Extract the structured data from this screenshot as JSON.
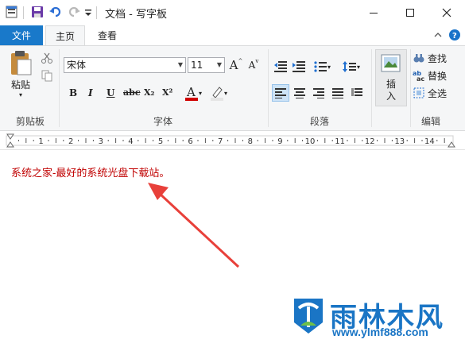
{
  "window": {
    "title": "文档 - 写字板"
  },
  "tabs": {
    "file": "文件",
    "home": "主页",
    "view": "查看"
  },
  "clipboard": {
    "paste": "粘贴",
    "group": "剪贴板"
  },
  "font": {
    "family": "宋体",
    "size": "11",
    "group": "字体",
    "bold": "B",
    "italic": "I",
    "underline": "U",
    "strikethrough": "abc",
    "subscript": "X₂",
    "superscript": "X²",
    "font_color_glyph": "A",
    "grow_glyph": "A",
    "shrink_glyph": "A"
  },
  "paragraph": {
    "group": "段落"
  },
  "insert": {
    "label_line1": "插",
    "label_line2": "入"
  },
  "editing": {
    "find": "查找",
    "replace": "替换",
    "select_all": "全选",
    "group": "编辑"
  },
  "ruler": {
    "numbers": [
      "1",
      "2",
      "3",
      "4",
      "5",
      "6",
      "7",
      "8",
      "9",
      "10",
      "11",
      "12",
      "13",
      "14"
    ]
  },
  "document": {
    "text": "系统之家-最好的系统光盘下载站。"
  },
  "watermark": {
    "name": "雨林木风",
    "url": "www.ylmf888.com"
  },
  "colors": {
    "accent": "#1979ca",
    "text_red": "#c00000",
    "arrow": "#e8403a",
    "watermark": "#1a75c5"
  },
  "icons": [
    "app-icon",
    "save-icon",
    "undo-icon",
    "redo-icon",
    "qa-dropdown-icon",
    "minimize-icon",
    "maximize-icon",
    "close-icon",
    "help-icon",
    "paste-icon",
    "cut-icon",
    "copy-icon",
    "font-color-icon",
    "highlight-icon",
    "picture-icon",
    "find-icon",
    "replace-icon",
    "select-all-icon"
  ]
}
